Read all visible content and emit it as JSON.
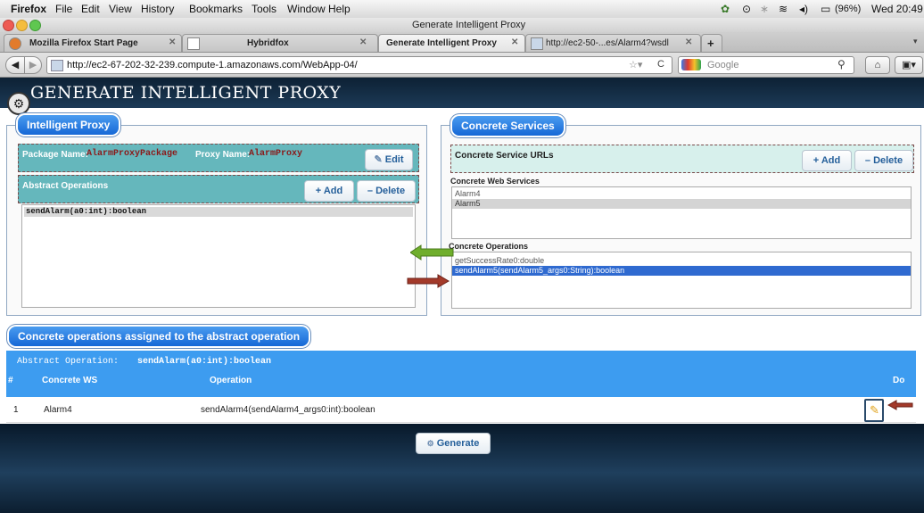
{
  "menubar": {
    "app": "Firefox",
    "items": [
      "File",
      "Edit",
      "View",
      "History",
      "Bookmarks",
      "Tools",
      "Window",
      "Help"
    ],
    "battery": "(96%)",
    "clock": "Wed 20:49"
  },
  "window": {
    "title": "Generate Intelligent Proxy"
  },
  "tabs": [
    {
      "label": "Mozilla Firefox Start Page",
      "active": false
    },
    {
      "label": "Hybridfox",
      "active": false
    },
    {
      "label": "Generate Intelligent Proxy",
      "active": true
    },
    {
      "label": "http://ec2-50-...es/Alarm4?wsdl",
      "active": false
    }
  ],
  "new_tab": "+",
  "nav": {
    "url": "http://ec2-67-202-32-239.compute-1.amazonaws.com/WebApp-04/",
    "search_placeholder": "Google"
  },
  "page": {
    "title": "GENERATE INTELLIGENT PROXY"
  },
  "intelligent_proxy": {
    "heading": "Intelligent Proxy",
    "package_label": "Package Name:",
    "package_value": "AlarmProxyPackage",
    "proxy_label": "Proxy Name:",
    "proxy_value": "AlarmProxy",
    "edit_button": "Edit",
    "abstract_ops_label": "Abstract Operations",
    "add_button": "+ Add",
    "delete_button": "– Delete",
    "abstract_ops": [
      "sendAlarm(a0:int):boolean"
    ]
  },
  "concrete_services": {
    "heading": "Concrete Services",
    "urls_label": "Concrete Service URLs",
    "add_button": "+ Add",
    "delete_button": "– Delete",
    "web_services_label": "Concrete Web Services",
    "web_services": [
      "Alarm4",
      "Alarm5"
    ],
    "operations_label": "Concrete Operations",
    "operations": [
      "getSuccessRate0:double",
      "sendAlarm5(sendAlarm5_args0:String):boolean"
    ]
  },
  "assigned": {
    "heading": "Concrete operations assigned to the abstract operation",
    "abstract_label": "Abstract Operation:",
    "abstract_value": "sendAlarm(a0:int):boolean",
    "columns": [
      "#",
      "Concrete WS",
      "Operation",
      "Do"
    ],
    "rows": [
      {
        "num": "1",
        "ws": "Alarm4",
        "operation": "sendAlarm4(sendAlarm4_args0:int):boolean"
      }
    ]
  },
  "generate_button": "Generate",
  "colors": {
    "accent": "#1668d6",
    "teal": "#65b7bc",
    "header_dark": "#0d2134",
    "value_red": "#8b1a1a"
  }
}
